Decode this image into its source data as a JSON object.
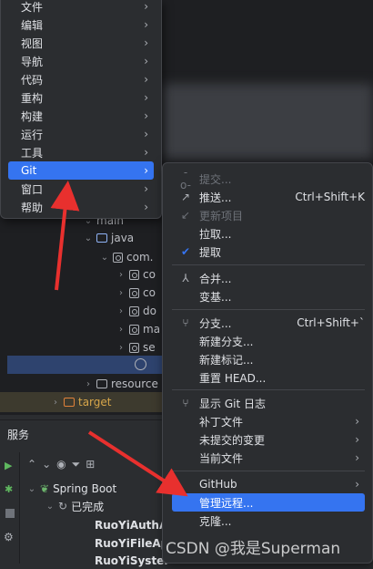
{
  "main_menu": {
    "items": [
      {
        "label": "文件"
      },
      {
        "label": "编辑"
      },
      {
        "label": "视图"
      },
      {
        "label": "导航"
      },
      {
        "label": "代码"
      },
      {
        "label": "重构"
      },
      {
        "label": "构建"
      },
      {
        "label": "运行"
      },
      {
        "label": "工具"
      },
      {
        "label": "Git"
      },
      {
        "label": "窗口"
      },
      {
        "label": "帮助"
      }
    ]
  },
  "git_menu": {
    "commit": "提交...",
    "push": "推送...",
    "push_shortcut": "Ctrl+Shift+K",
    "update_project": "更新项目",
    "pull": "拉取...",
    "fetch": "提取",
    "merge": "合并...",
    "rebase": "变基...",
    "branches": "分支...",
    "branches_shortcut": "Ctrl+Shift+`",
    "new_branch": "新建分支...",
    "new_tag": "新建标记...",
    "reset_head": "重置 HEAD...",
    "show_log": "显示 Git 日志",
    "patch_file": "补丁文件",
    "uncommitted": "未提交的变更",
    "current_file": "当前文件",
    "github": "GitHub",
    "manage_remotes": "管理远程...",
    "clone": "克隆..."
  },
  "project_tree": {
    "main": "main",
    "java": "java",
    "com": "com.",
    "pkg1": "co",
    "pkg2": "co",
    "pkg3": "do",
    "pkg4": "ma",
    "pkg5": "se",
    "resources": "resource",
    "target": "target"
  },
  "services": {
    "title": "服务",
    "spring_boot": "Spring Boot",
    "finished": "已完成",
    "app1": "RuoYiAuthA",
    "app2": "RuoYiFileAp",
    "app3": "RuoYiSyster"
  },
  "watermark": "CSDN @我是Superman"
}
